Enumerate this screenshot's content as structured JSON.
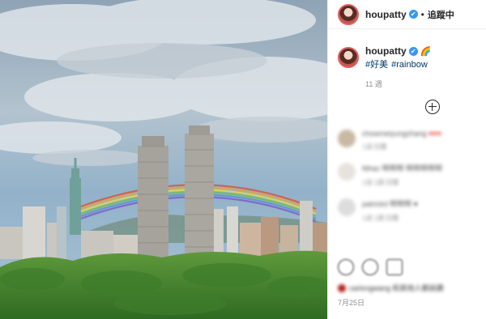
{
  "post": {
    "username": "houpatty",
    "verified_mark": "✔",
    "separator": "•",
    "follow_label": "追蹤中",
    "caption_emoji": "🌈",
    "hashtags": [
      "#好美",
      "#rainbow"
    ],
    "time_ago": "11 週",
    "date": "7月25日",
    "load_more_icon": "plus-circle-icon"
  },
  "comments": [
    {
      "text": "chowmeiyungzhang",
      "tag": "♥♥♥",
      "meta": "1週  回覆"
    },
    {
      "text": "fdhaz 啊啊啊 啊啊啊啊啊",
      "tag": "",
      "meta": "1週  1讚  回覆"
    },
    {
      "text": "patrickd 啊啊啊 ♥",
      "tag": "",
      "meta": "1週  1讚  回覆"
    }
  ],
  "likes_text": "carlongwang 和其他人都說讚",
  "colors": {
    "accent": "#3897f0",
    "link": "#00376b",
    "muted": "#8e8e8e"
  }
}
